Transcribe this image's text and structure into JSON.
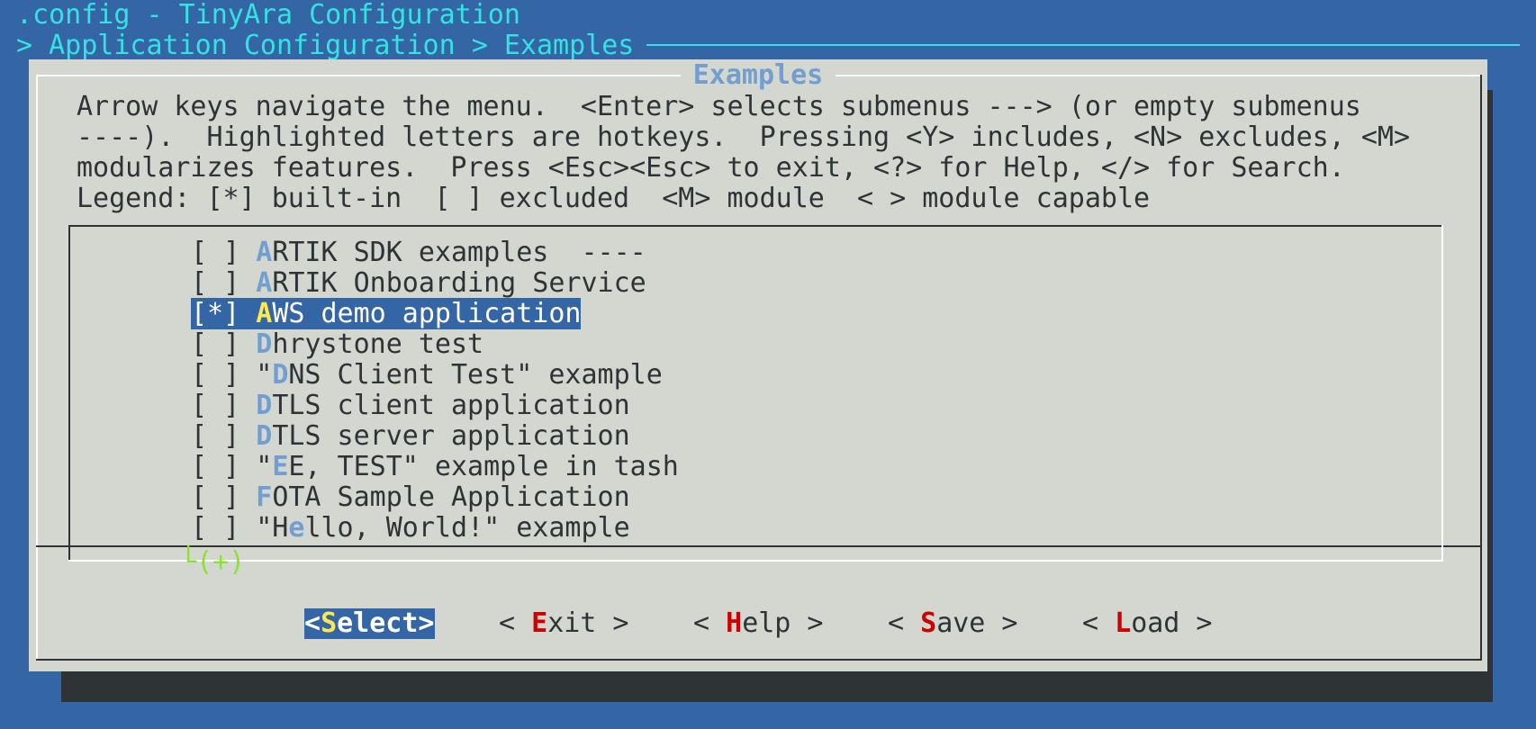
{
  "header": {
    "title": ".config - TinyAra Configuration",
    "breadcrumb": "> Application Configuration > Examples"
  },
  "dialog": {
    "title": "Examples",
    "help_lines": [
      "Arrow keys navigate the menu.  <Enter> selects submenus ---> (or empty submenus",
      "----).  Highlighted letters are hotkeys.  Pressing <Y> includes, <N> excludes, <M>",
      "modularizes features.  Press <Esc><Esc> to exit, <?> for Help, </> for Search.",
      "Legend: [*] built-in  [ ] excluded  <M> module  < > module capable"
    ]
  },
  "menu": {
    "items": [
      {
        "check": "[ ]",
        "pre": "",
        "hotkey": "A",
        "rest": "RTIK SDK examples  ----"
      },
      {
        "check": "[ ]",
        "pre": "",
        "hotkey": "A",
        "rest": "RTIK Onboarding Service"
      },
      {
        "check": "[*]",
        "pre": "",
        "hotkey": "A",
        "rest": "WS demo application",
        "selected": true
      },
      {
        "check": "[ ]",
        "pre": "",
        "hotkey": "D",
        "rest": "hrystone test"
      },
      {
        "check": "[ ]",
        "pre": "\"",
        "hotkey": "D",
        "rest": "NS Client Test\" example"
      },
      {
        "check": "[ ]",
        "pre": "",
        "hotkey": "D",
        "rest": "TLS client application"
      },
      {
        "check": "[ ]",
        "pre": "",
        "hotkey": "D",
        "rest": "TLS server application"
      },
      {
        "check": "[ ]",
        "pre": "\"",
        "hotkey": "E",
        "rest": "E, TEST\" example in tash"
      },
      {
        "check": "[ ]",
        "pre": "",
        "hotkey": "F",
        "rest": "OTA Sample Application"
      },
      {
        "check": "[ ]",
        "pre": "\"H",
        "hotkey": "e",
        "rest": "llo, World!\" example"
      }
    ],
    "more_indicator": "(+)"
  },
  "buttons": {
    "select": {
      "pre": "<",
      "hotkey": "S",
      "post": "elect>"
    },
    "exit": {
      "pre": "< ",
      "hotkey": "E",
      "post": "xit >"
    },
    "help": {
      "pre": "< ",
      "hotkey": "H",
      "post": "elp >"
    },
    "save": {
      "pre": "< ",
      "hotkey": "S",
      "post": "ave >"
    },
    "load": {
      "pre": "< ",
      "hotkey": "L",
      "post": "oad >"
    }
  },
  "colors": {
    "background": "#3465a4",
    "dialog": "#d3d7cf",
    "shadow": "#2e3436",
    "title_text": "#34e2e2",
    "hotkey": "#729fcf",
    "selected_bg": "#3465a4",
    "selected_hotkey": "#fce94f",
    "button_hotkey": "#cc0000",
    "more_indicator": "#8ae234"
  }
}
